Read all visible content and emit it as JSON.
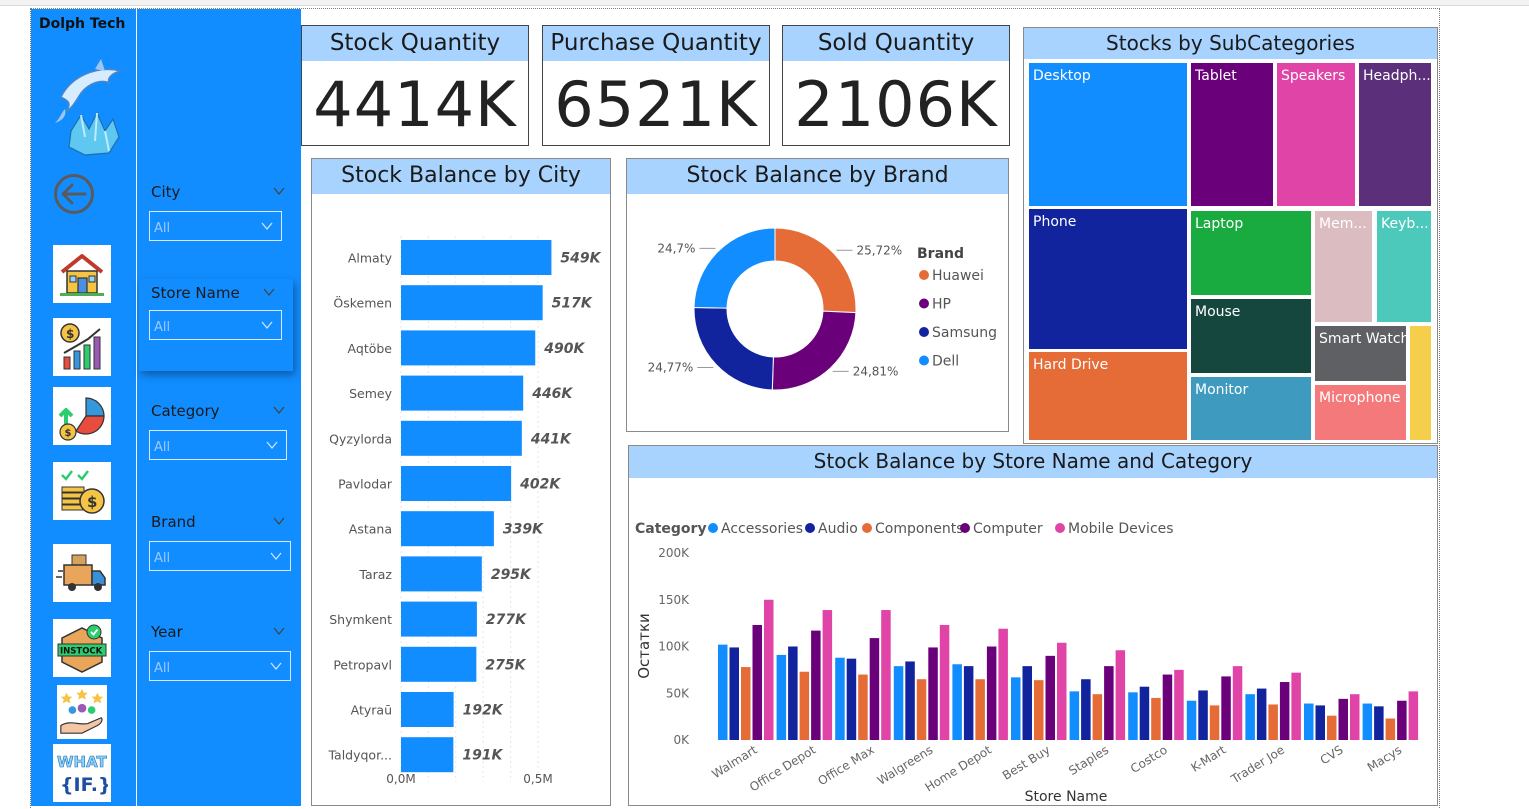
{
  "nav": {
    "title": "Dolph Tech",
    "icons": [
      "home-icon",
      "finance-chart-icon",
      "pie-growth-icon",
      "coins-check-icon",
      "delivery-truck-icon",
      "in-stock-box-icon",
      "customers-hand-icon",
      "what-if-icon"
    ],
    "instock_text": "INSTOCK",
    "whatif_line1": "WHAT",
    "whatif_line2": "{IF.}"
  },
  "filters": [
    {
      "label": "City",
      "value": "All"
    },
    {
      "label": "Store Name",
      "value": "All"
    },
    {
      "label": "Category",
      "value": "All"
    },
    {
      "label": "Brand",
      "value": "All"
    },
    {
      "label": "Year",
      "value": "All"
    }
  ],
  "kpis": [
    {
      "label": "Stock Quantity",
      "value": "4414K"
    },
    {
      "label": "Purchase Quantity",
      "value": "6521K"
    },
    {
      "label": "Sold Quantity",
      "value": "2106K"
    }
  ],
  "colors": {
    "accent": "#118dff",
    "header": "#a8d3ff",
    "accessories": "#118dff",
    "audio": "#12239e",
    "components": "#e66c37",
    "computer": "#6b007b",
    "mobile": "#e044a7"
  },
  "chart_data": [
    {
      "type": "bar",
      "orientation": "horizontal",
      "title": "Stock Balance by City",
      "categories": [
        "Almaty",
        "Öskemen",
        "Aqtöbe",
        "Semey",
        "Qyzylorda",
        "Pavlodar",
        "Astana",
        "Taraz",
        "Shymkent",
        "Petropavl",
        "Atyraū",
        "Taldyqor..."
      ],
      "values": [
        549,
        517,
        490,
        446,
        441,
        402,
        339,
        295,
        277,
        275,
        192,
        191
      ],
      "value_labels": [
        "549K",
        "517K",
        "490K",
        "446K",
        "441K",
        "402K",
        "339K",
        "295K",
        "277K",
        "275K",
        "192K",
        "191K"
      ],
      "unit": "K",
      "xlim": [
        0,
        600
      ],
      "tick_values": [
        0,
        500
      ],
      "tick_labels": [
        "0,0M",
        "0,5M"
      ],
      "grid": true
    },
    {
      "type": "pie",
      "subtype": "donut",
      "title": "Stock Balance by Brand",
      "legend_title": "Brand",
      "legend_position": "right",
      "categories": [
        "Huawei",
        "HP",
        "Samsung",
        "Dell"
      ],
      "values": [
        25.72,
        24.81,
        24.77,
        24.7
      ],
      "value_labels": [
        "25,72%",
        "24,81%",
        "24,77%",
        "24,7%"
      ],
      "colors": [
        "#e66c37",
        "#6b007b",
        "#12239e",
        "#118dff"
      ]
    },
    {
      "type": "heatmap",
      "subtype": "treemap",
      "title": "Stocks by SubCategories",
      "categories": [
        "Desktop",
        "Phone",
        "Hard Drive",
        "Tablet",
        "Speakers",
        "Headph...",
        "Laptop",
        "Mouse",
        "Monitor",
        "Mem...",
        "Keyb...",
        "Smart Watch",
        "Microphone",
        ""
      ],
      "colors": [
        "#118dff",
        "#12239e",
        "#e66c37",
        "#6b007b",
        "#e044a7",
        "#5b2f7a",
        "#1aab40",
        "#15473f",
        "#3e9bbf",
        "#dbbcc0",
        "#4dc9bc",
        "#5e6064",
        "#f4797a",
        "#f5cf4b"
      ]
    },
    {
      "type": "bar",
      "orientation": "vertical",
      "title": "Stock Balance by Store Name and Category",
      "legend_title": "Category",
      "legend_position": "top-left",
      "xlabel": "Store Name",
      "ylabel": "Остатки",
      "ylim": [
        0,
        200
      ],
      "y_tick_values": [
        0,
        50,
        100,
        150,
        200
      ],
      "y_tick_labels": [
        "0K",
        "50K",
        "100K",
        "150K",
        "200K"
      ],
      "categories": [
        "Walmart",
        "Office Depot",
        "Office Max",
        "Walgreens",
        "Home Depot",
        "Best Buy",
        "Staples",
        "Costco",
        "K-Mart",
        "Trader Joe",
        "CVS",
        "Macys"
      ],
      "series": [
        {
          "name": "Accessories",
          "color": "#118dff",
          "values": [
            102,
            91,
            88,
            79,
            81,
            67,
            52,
            51,
            42,
            49,
            39,
            39
          ]
        },
        {
          "name": "Audio",
          "color": "#12239e",
          "values": [
            99,
            100,
            87,
            84,
            79,
            79,
            65,
            57,
            53,
            55,
            37,
            36
          ]
        },
        {
          "name": "Components",
          "color": "#e66c37",
          "values": [
            78,
            73,
            70,
            65,
            65,
            64,
            49,
            45,
            37,
            38,
            26,
            23
          ]
        },
        {
          "name": "Computer",
          "color": "#6b007b",
          "values": [
            123,
            117,
            109,
            99,
            100,
            90,
            79,
            70,
            68,
            62,
            44,
            42
          ]
        },
        {
          "name": "Mobile Devices",
          "color": "#e044a7",
          "values": [
            150,
            139,
            139,
            123,
            119,
            104,
            96,
            75,
            79,
            72,
            49,
            52
          ]
        }
      ],
      "grid": false
    }
  ]
}
